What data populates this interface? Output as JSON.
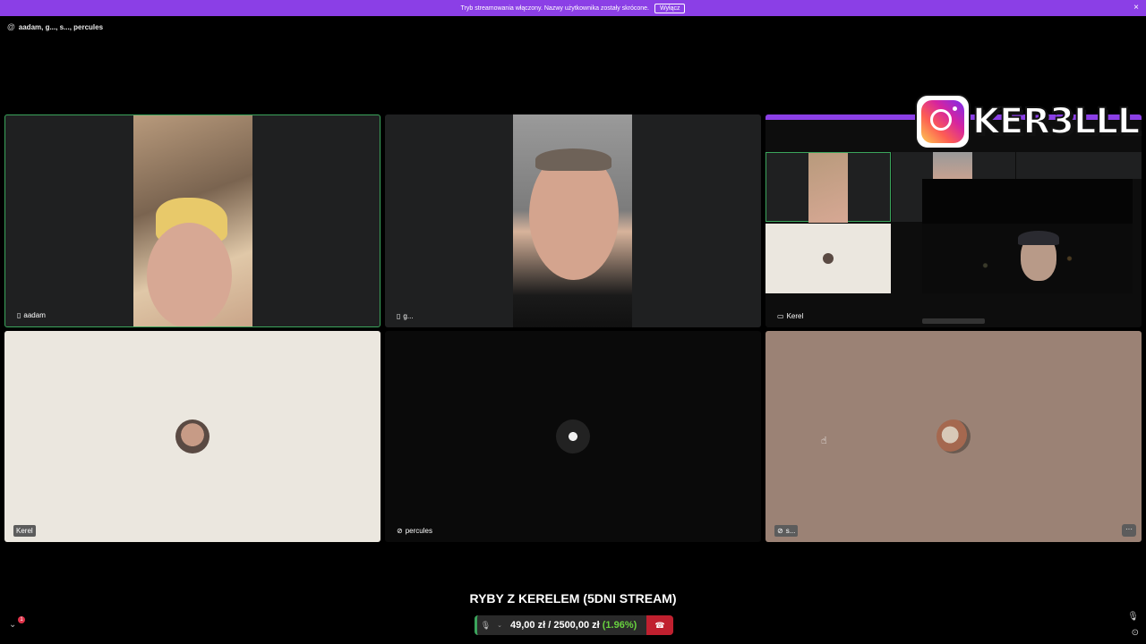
{
  "banner": {
    "text": "Tryb streamowania włączony. Nazwy użytkownika zostały skrócone.",
    "button": "Wyłącz",
    "close": "×"
  },
  "call": {
    "title": "aadam, g..., s..., percules",
    "icon": "at-icon"
  },
  "tiles": [
    {
      "label": "aadam",
      "icon": "phone-icon",
      "speaking": true
    },
    {
      "label": "g...",
      "icon": "phone-icon"
    },
    {
      "label": "Kerel",
      "icon": "screen-share-icon"
    },
    {
      "label": "Kerel"
    },
    {
      "label": "percules",
      "icon": "mic-muted-icon"
    },
    {
      "label": "s...",
      "icon": "mic-muted-icon"
    }
  ],
  "overlay": {
    "instagram_handle": "KER3LLL"
  },
  "stream": {
    "title": "RYBY Z KERELEM (5DNI STREAM)",
    "goal_current": "49,00 zł",
    "goal_separator": "/",
    "goal_target": "2500,00 zł",
    "goal_percent": "(1.96%)"
  },
  "controls": {
    "notification_count": "1"
  },
  "colors": {
    "banner": "#8b3fe6",
    "speaking": "#3ba55c",
    "hangup": "#c0202f",
    "goal_percent": "#68d13f"
  }
}
